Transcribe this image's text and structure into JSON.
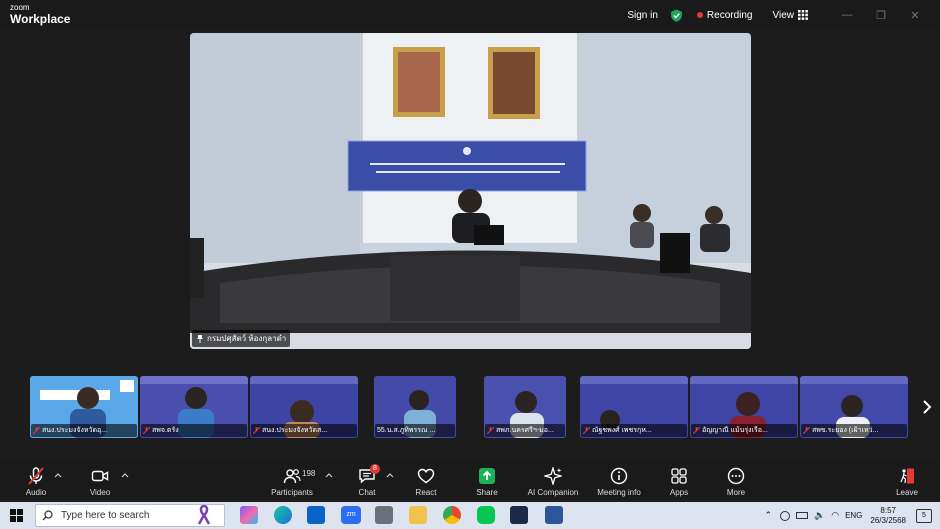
{
  "app": {
    "logo_top": "zoom",
    "logo_bottom": "Workplace"
  },
  "titlebar": {
    "sign_in": "Sign in",
    "recording": "Recording",
    "view": "View"
  },
  "main_video": {
    "name": "กรมปศุสัตว์ ห้องกุลาดำ"
  },
  "participants": [
    {
      "name": "สนง.ประมงจังหวัดอุ..."
    },
    {
      "name": "สพจ.ตรัง"
    },
    {
      "name": "สนง.ประมงจังหวัดส..."
    },
    {
      "name": "55.น.ส.ภูทิพรรณ ..."
    },
    {
      "name": "สพภ.นครศรีฯ-มอ..."
    },
    {
      "name": "ณัฐชพงศ์ เพชรกุห..."
    },
    {
      "name": "อัญญาณี แม้นรุ่งเรือ..."
    },
    {
      "name": "สพข.ระยอง (เฝ้าเหว่..."
    }
  ],
  "toolbar": {
    "audio": "Audio",
    "video": "Video",
    "participants": "Participants",
    "participants_count": "198",
    "chat": "Chat",
    "chat_badge": "8",
    "react": "React",
    "share": "Share",
    "ai_companion": "AI Companion",
    "meeting_info": "Meeting info",
    "apps": "Apps",
    "more": "More",
    "leave": "Leave"
  },
  "taskbar": {
    "search_placeholder": "Type here to search",
    "lang": "ENG",
    "time": "8:57",
    "date": "26/3/2568",
    "notif_count": "5"
  },
  "colors": {
    "accent_green": "#1ea55b",
    "record_red": "#e53935",
    "share_green": "#1fb157"
  }
}
